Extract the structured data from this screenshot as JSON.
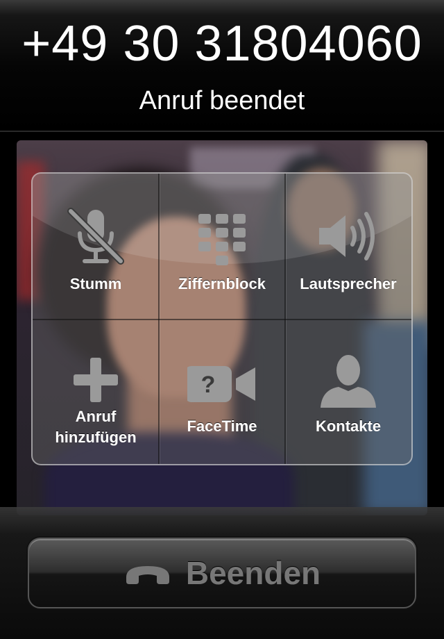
{
  "call": {
    "number": "+49 30 31804060",
    "status": "Anruf beendet"
  },
  "controls": [
    {
      "icon": "mute-microphone-icon",
      "label": "Stumm"
    },
    {
      "icon": "keypad-icon",
      "label": "Ziffernblock"
    },
    {
      "icon": "speaker-icon",
      "label": "Lautsprecher"
    },
    {
      "icon": "add-call-icon",
      "label_line1": "Anruf",
      "label_line2": "hinzufügen"
    },
    {
      "icon": "facetime-icon",
      "label": "FaceTime"
    },
    {
      "icon": "contacts-icon",
      "label": "Kontakte"
    }
  ],
  "end_button": {
    "icon": "phone-handset-icon",
    "label": "Beenden"
  },
  "colors": {
    "icon_gray": "#9a9a9a",
    "label_white": "#ffffff",
    "end_label_gray": "#777777"
  }
}
